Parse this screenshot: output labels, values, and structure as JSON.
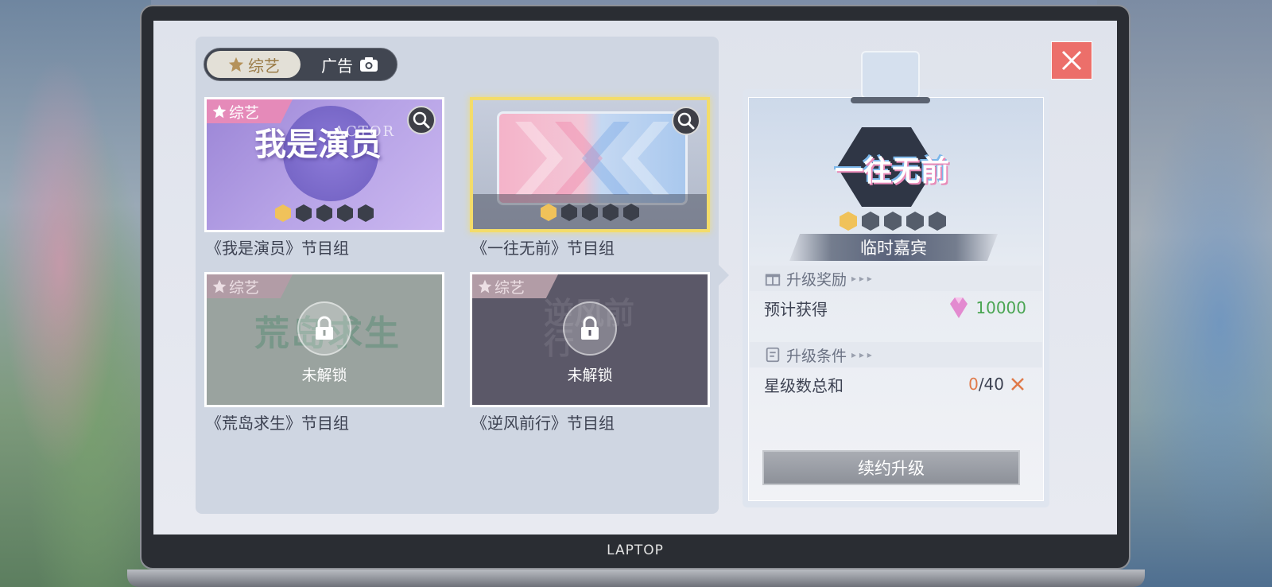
{
  "brand": "LAPTOP",
  "tabs": {
    "variety": "综艺",
    "ad": "广告"
  },
  "cards": [
    {
      "ribbon": "综艺",
      "logo": "我是演员",
      "logo_sub": "ACTOR",
      "caption": "《我是演员》节目组",
      "stars": 1,
      "max_stars": 5
    },
    {
      "caption": "《一往无前》节目组",
      "stars": 1,
      "max_stars": 5
    },
    {
      "ribbon": "综艺",
      "logo": "荒岛求生",
      "lock_text": "未解锁",
      "caption": "《荒岛求生》节目组"
    },
    {
      "ribbon": "综艺",
      "logo": "逆风前行",
      "lock_text": "未解锁",
      "caption": "《逆风前行》节目组"
    }
  ],
  "detail": {
    "emblem": "一往无前",
    "stars": 1,
    "max_stars": 5,
    "rank": "临时嘉宾",
    "reward_section": "升级奖励",
    "reward_label": "预计获得",
    "reward_value": "10000",
    "cond_section": "升级条件",
    "cond_label": "星级数总和",
    "cond_current": "0",
    "cond_total": "/40",
    "button": "续约升级"
  },
  "colors": {
    "accent_pink": "#e58ab9",
    "gold": "#f0c25a",
    "close_red": "#ec6f6a",
    "reward_green": "#4aa552"
  },
  "icons": [
    "star-icon",
    "camera-icon",
    "search-icon",
    "lock-icon",
    "gift-icon",
    "scroll-icon",
    "close-icon",
    "gem-icon",
    "cross-icon"
  ]
}
